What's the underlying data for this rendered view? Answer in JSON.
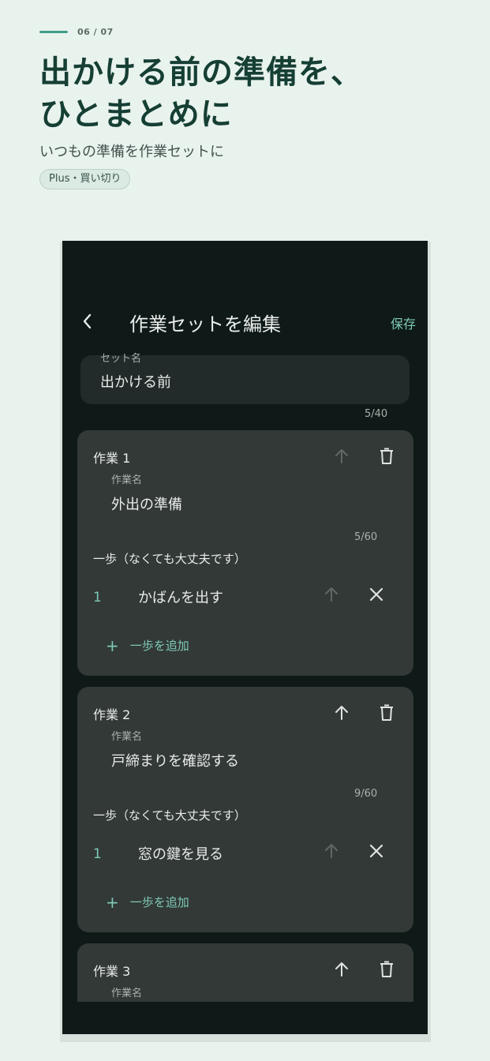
{
  "header": {
    "progress": "06 / 07",
    "headline_line1": "出かける前の準備を、",
    "headline_line2": "ひとまとめに",
    "subtitle": "いつもの準備を作業セットに",
    "badge": "Plus・買い切り"
  },
  "appbar": {
    "back_icon": "chevron-left-icon",
    "title": "作業セットを編集",
    "save_label": "保存"
  },
  "set_name": {
    "label": "セット名",
    "value": "出かける前",
    "counter": "5/40"
  },
  "tasks": [
    {
      "title": "作業 1",
      "name_label": "作業名",
      "name_value": "外出の準備",
      "counter": "5/60",
      "steps_label": "一歩（なくても大丈夫です）",
      "steps": [
        {
          "number": "1",
          "text": "かばんを出す"
        }
      ],
      "add_step_label": "一歩を追加",
      "move_up_enabled": false
    },
    {
      "title": "作業 2",
      "name_label": "作業名",
      "name_value": "戸締まりを確認する",
      "counter": "9/60",
      "steps_label": "一歩（なくても大丈夫です）",
      "steps": [
        {
          "number": "1",
          "text": "窓の鍵を見る"
        }
      ],
      "add_step_label": "一歩を追加",
      "move_up_enabled": true
    },
    {
      "title": "作業 3",
      "name_label": "作業名",
      "move_up_enabled": true
    }
  ],
  "colors": {
    "accent": "#7fc9b6",
    "headline": "#163f34",
    "page_background": "#e9f3ee",
    "app_background": "#0f1a18",
    "card_background": "#323937"
  }
}
